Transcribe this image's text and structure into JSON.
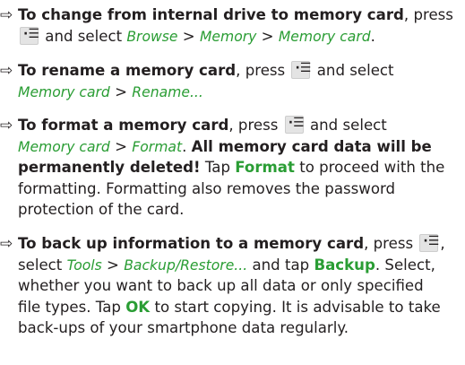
{
  "items": [
    {
      "l1": {
        "bold": "To change from internal drive to memory card",
        "text": ", press"
      },
      "l2": {
        "after_key": "and select",
        "a": "Browse",
        "sep1": ">",
        "b": "Memory",
        "sep2": ">",
        "c": "Memory card",
        "end": "."
      }
    },
    {
      "l1": {
        "bold": "To rename a memory card",
        "text": ", press",
        "after_key": "and select"
      },
      "l2": {
        "a": "Memory card",
        "sep1": ">",
        "b": "Rename..."
      }
    },
    {
      "l1": {
        "bold": "To format a memory card",
        "text": ", press",
        "after_key": "and select"
      },
      "l2": {
        "a": "Memory card",
        "sep1": ">",
        "b": "Format",
        "dot": ".",
        "bold": "All memory card data will be"
      },
      "l3": {
        "bold": "permanently deleted!",
        "t1": "Tap",
        "kw": "Format",
        "t2": "to proceed with the"
      },
      "l4": "formatting. Formatting also removes the password",
      "l5": "protection of the card."
    },
    {
      "l1": {
        "bold": "To back up information to a memory card",
        "text": ", press",
        "comma": ","
      },
      "l2": {
        "t1": "select",
        "a": "Tools",
        "sep1": ">",
        "b": "Backup/Restore...",
        "t2": "and tap",
        "kw": "Backup",
        "t3": ". Select,"
      },
      "l3": "whether you want to back up all data or only specified",
      "l4": {
        "t1": "file types. Tap",
        "kw": "OK",
        "t2": "to start copying. It is advisable to take"
      },
      "l5": "back-ups of your smartphone data regularly."
    }
  ]
}
